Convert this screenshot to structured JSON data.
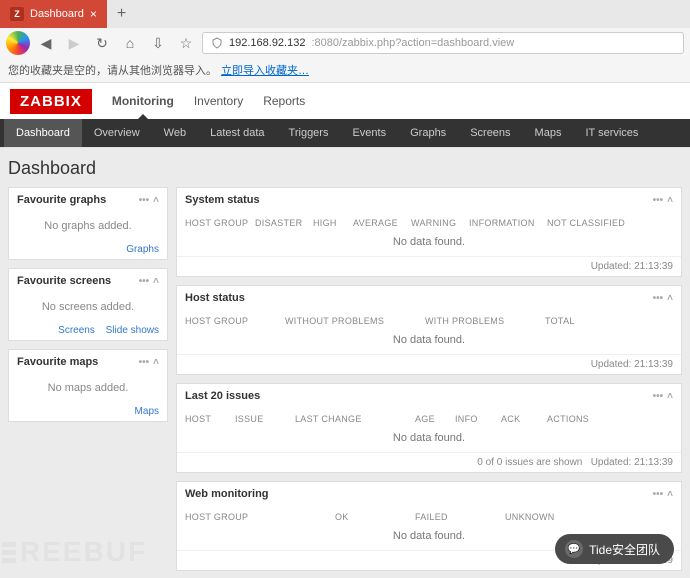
{
  "browser": {
    "tab_title": "Dashboard",
    "tab_icon_letter": "Z",
    "url_host": "192.168.92.132",
    "url_port_path": ":8080/zabbix.php?action=dashboard.view",
    "bookmarks_empty": "您的收藏夹是空的，请从其他浏览器导入。",
    "bookmarks_link": "立即导入收藏夹…"
  },
  "header": {
    "logo": "ZABBIX",
    "menu1": [
      "Monitoring",
      "Inventory",
      "Reports"
    ],
    "menu1_active": 0,
    "menu2": [
      "Dashboard",
      "Overview",
      "Web",
      "Latest data",
      "Triggers",
      "Events",
      "Graphs",
      "Screens",
      "Maps",
      "IT services"
    ],
    "menu2_active": 0
  },
  "page_title": "Dashboard",
  "left_panels": [
    {
      "title": "Favourite graphs",
      "empty": "No graphs added.",
      "links": [
        "Graphs"
      ]
    },
    {
      "title": "Favourite screens",
      "empty": "No screens added.",
      "links": [
        "Screens",
        "Slide shows"
      ]
    },
    {
      "title": "Favourite maps",
      "empty": "No maps added.",
      "links": [
        "Maps"
      ]
    }
  ],
  "right_panels": {
    "system": {
      "title": "System status",
      "cols": [
        "HOST GROUP",
        "DISASTER",
        "HIGH",
        "AVERAGE",
        "WARNING",
        "INFORMATION",
        "NOT CLASSIFIED"
      ],
      "no_data": "No data found.",
      "updated": "Updated: 21:13:39"
    },
    "host": {
      "title": "Host status",
      "cols": [
        "HOST GROUP",
        "WITHOUT PROBLEMS",
        "WITH PROBLEMS",
        "TOTAL"
      ],
      "no_data": "No data found.",
      "updated": "Updated: 21:13:39"
    },
    "issues": {
      "title": "Last 20 issues",
      "cols": [
        "HOST",
        "ISSUE",
        "LAST CHANGE",
        "AGE",
        "INFO",
        "ACK",
        "ACTIONS"
      ],
      "no_data": "No data found.",
      "shown": "0 of 0 issues are shown",
      "updated": "Updated: 21:13:39"
    },
    "web": {
      "title": "Web monitoring",
      "cols": [
        "HOST GROUP",
        "OK",
        "FAILED",
        "UNKNOWN"
      ],
      "no_data": "No data found.",
      "updated": "Updated: 21:13:39"
    }
  },
  "watermark": "REEBUF",
  "chat": "Tide安全团队"
}
